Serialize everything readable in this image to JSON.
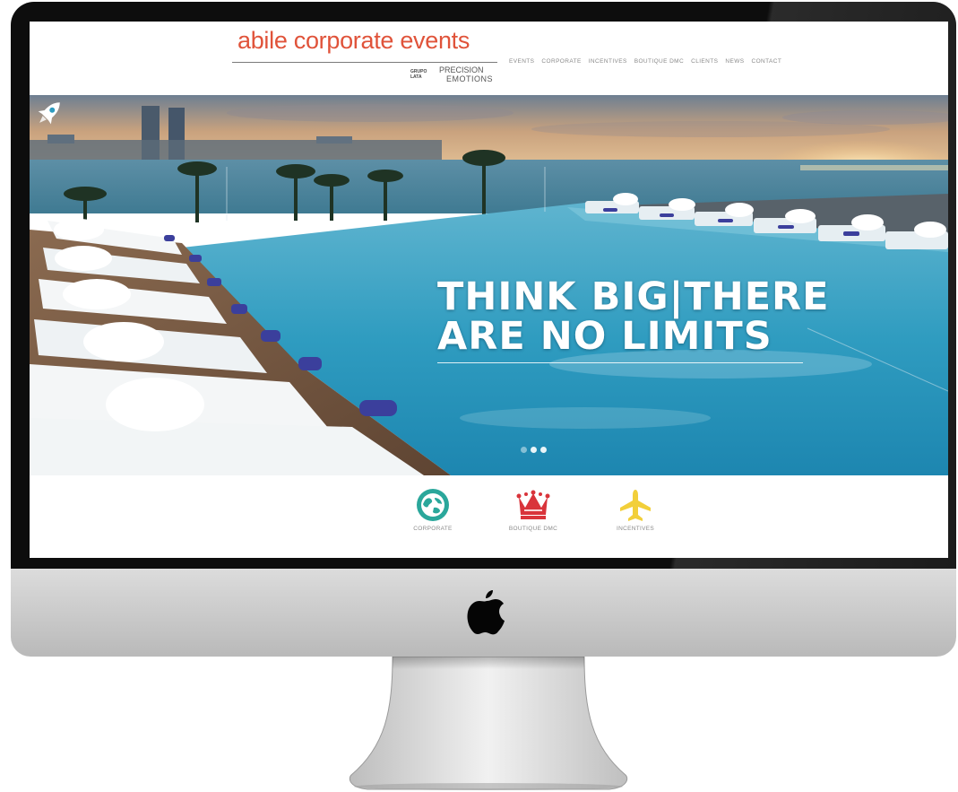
{
  "site": {
    "brand": "abile corporate events",
    "sub_logo": {
      "small_text": "GRUPO LATA",
      "line1": "PRECISION",
      "line2": "EMOTIONS"
    }
  },
  "nav": {
    "items": [
      {
        "label": "EVENTS"
      },
      {
        "label": "CORPORATE"
      },
      {
        "label": "INCENTIVES"
      },
      {
        "label": "BOUTIQUE DMC"
      },
      {
        "label": "CLIENTS"
      },
      {
        "label": "NEWS"
      },
      {
        "label": "CONTACT"
      }
    ]
  },
  "hero": {
    "line1": "THINK BIG|THERE",
    "line2": "ARE NO LIMITS",
    "icon": "rocket-icon",
    "slides": 3,
    "active_slide": 3
  },
  "services": [
    {
      "label": "CORPORATE",
      "icon": "globe-icon",
      "color": "#2aa79b"
    },
    {
      "label": "BOUTIQUE DMC",
      "icon": "crown-icon",
      "color": "#d9343b"
    },
    {
      "label": "INCENTIVES",
      "icon": "airplane-icon",
      "color": "#f2cf3a"
    }
  ],
  "colors": {
    "brand": "#e0533a",
    "frame": "#0d0d0d",
    "chin": "#c9c9c9"
  }
}
